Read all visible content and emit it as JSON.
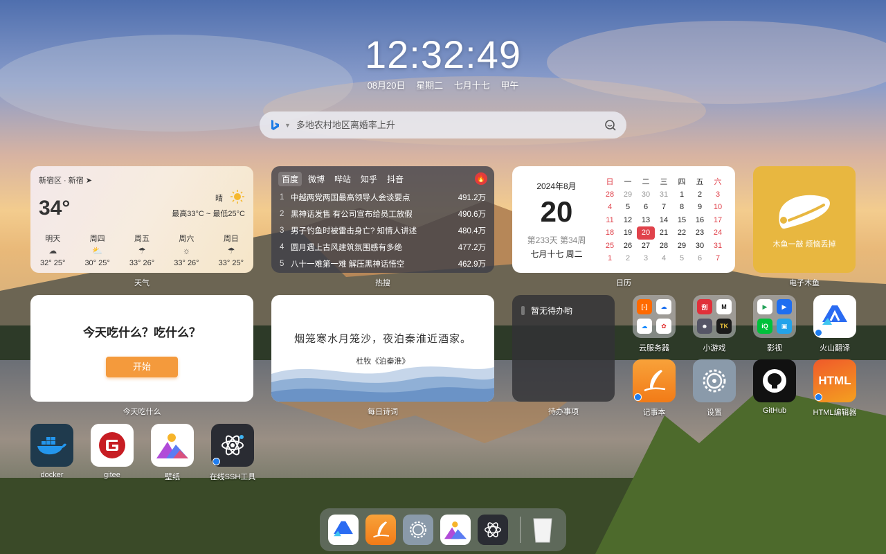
{
  "clock": {
    "time": "12:32:49",
    "date": "08月20日",
    "weekday": "星期二",
    "lunar": "七月十七",
    "ganzhi": "甲午"
  },
  "search": {
    "placeholder": "多地农村地区离婚率上升"
  },
  "weather": {
    "location": "新宿区 · 新宿",
    "temp": "34°",
    "condition": "晴",
    "range": "最高33°C ~ 最低25°C",
    "days": [
      {
        "name": "明天",
        "temps": "32° 25°"
      },
      {
        "name": "周四",
        "temps": "30° 25°"
      },
      {
        "name": "周五",
        "temps": "33° 26°"
      },
      {
        "name": "周六",
        "temps": "33° 26°"
      },
      {
        "name": "周日",
        "temps": "33° 25°"
      }
    ],
    "label": "天气"
  },
  "hot": {
    "tabs": [
      "百度",
      "微博",
      "哔站",
      "知乎",
      "抖音"
    ],
    "items": [
      {
        "n": "1",
        "title": "中越两党两国最高领导人会谈要点",
        "value": "491.2万"
      },
      {
        "n": "2",
        "title": "黑神话发售 有公司宣布给员工放假",
        "value": "490.6万"
      },
      {
        "n": "3",
        "title": "男子钓鱼时被雷击身亡? 知情人讲述",
        "value": "480.4万"
      },
      {
        "n": "4",
        "title": "圆月遇上古风建筑氛围感有多绝",
        "value": "477.2万"
      },
      {
        "n": "5",
        "title": "八十一难第一难 解压黑神话悟空",
        "value": "462.9万"
      }
    ],
    "label": "热搜"
  },
  "calendar": {
    "ym": "2024年8月",
    "day": "20",
    "week": "第233天 第34周",
    "lunar": "七月十七 周二",
    "headers": [
      "日",
      "一",
      "二",
      "三",
      "四",
      "五",
      "六"
    ],
    "rows": [
      [
        "28",
        "29",
        "30",
        "31",
        "1",
        "2",
        "3"
      ],
      [
        "4",
        "5",
        "6",
        "7",
        "8",
        "9",
        "10"
      ],
      [
        "11",
        "12",
        "13",
        "14",
        "15",
        "16",
        "17"
      ],
      [
        "18",
        "19",
        "20",
        "21",
        "22",
        "23",
        "24"
      ],
      [
        "25",
        "26",
        "27",
        "28",
        "29",
        "30",
        "31"
      ],
      [
        "1",
        "2",
        "3",
        "4",
        "5",
        "6",
        "7"
      ]
    ],
    "label": "日历"
  },
  "muyu": {
    "text": "木鱼一敲 烦恼丢掉",
    "label": "电子木鱼"
  },
  "eat": {
    "question": "今天吃什么？吃什么？",
    "button": "开始",
    "label": "今天吃什么"
  },
  "poem": {
    "line": "烟笼寒水月笼沙，夜泊秦淮近酒家。",
    "author": "杜牧《泊秦淮》",
    "label": "每日诗词"
  },
  "todo": {
    "text": "暂无待办哟",
    "label": "待办事项"
  },
  "apps": {
    "cloud": "云服务器",
    "games": "小游戏",
    "video": "影视",
    "translate": "火山翻译",
    "notes": "记事本",
    "settings": "设置",
    "github": "GitHub",
    "html": "HTML编辑器",
    "html_icon": "HTML",
    "docker": "docker",
    "gitee": "gitee",
    "wallpaper": "壁纸",
    "ssh": "在线SSH工具"
  },
  "colors": {
    "accent": "#e0424b",
    "orange": "#f49a3c",
    "muyu": "#e8b740"
  }
}
